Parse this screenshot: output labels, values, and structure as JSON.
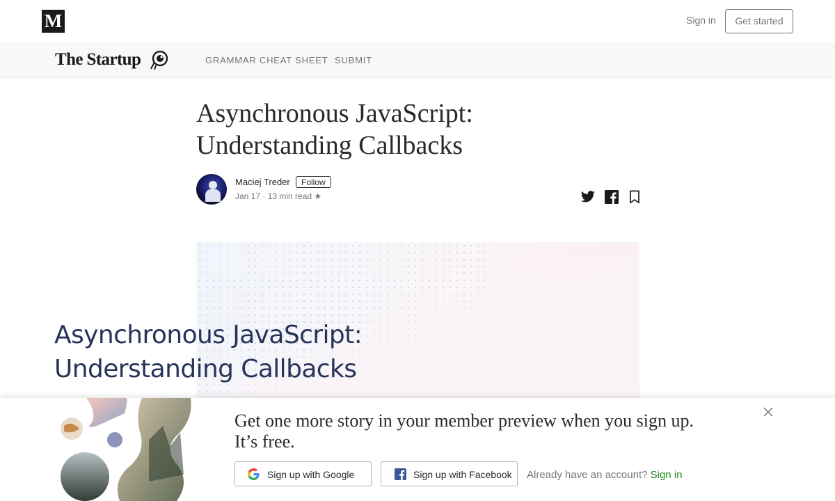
{
  "topbar": {
    "logo_letter": "M",
    "sign_in": "Sign in",
    "get_started": "Get started"
  },
  "publication": {
    "name": "The Startup",
    "nav": [
      "GRAMMAR CHEAT SHEET",
      "SUBMIT"
    ]
  },
  "article": {
    "title_line1": "Asynchronous JavaScript:",
    "title_line2": "Understanding Callbacks",
    "author": "Maciej Treder",
    "follow": "Follow",
    "meta": "Jan 17 · 13 min read ★",
    "hero_line1": "Asynchronous JavaScript:",
    "hero_line2": "Understanding Callbacks"
  },
  "signup_overlay": {
    "message_line1": "Get one more story in your member preview when you sign up.",
    "message_line2": "It’s free.",
    "google_button": "Sign up with Google",
    "facebook_button": "Sign up with Facebook",
    "already_text": "Already have an account?",
    "sign_in": "Sign in"
  },
  "icons": {
    "logo": "medium-m-icon",
    "share": [
      "twitter-icon",
      "facebook-icon",
      "bookmark-icon"
    ],
    "close": "close-icon",
    "google": "google-icon",
    "facebook": "facebook-icon"
  },
  "colors": {
    "accent_green": "#1a8917",
    "text_dark": "#292929",
    "text_muted": "#757575",
    "hero_text": "#27345a"
  }
}
